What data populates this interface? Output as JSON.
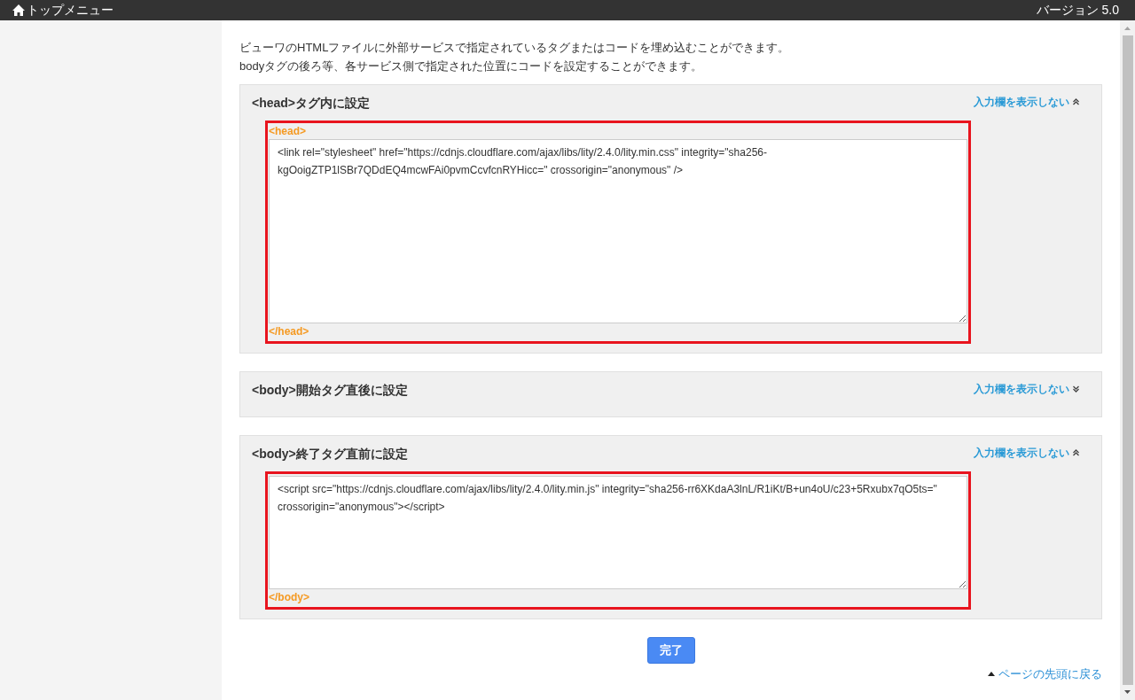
{
  "header": {
    "title": "トップメニュー",
    "version": "バージョン 5.0"
  },
  "intro": [
    "ビューワのHTMLファイルに外部サービスで指定されているタグまたはコードを埋め込むことができます。",
    "bodyタグの後ろ等、各サービス側で指定された位置にコードを設定することができます。"
  ],
  "sections": [
    {
      "title": "<head>タグ内に設定",
      "toggle": "入力欄を表示しない",
      "expanded": true,
      "open_tag": "<head>",
      "code": "<link rel=\"stylesheet\" href=\"https://cdnjs.cloudflare.com/ajax/libs/lity/2.4.0/lity.min.css\" integrity=\"sha256-kgOoigZTP1lSBr7QDdEQ4mcwFAi0pvmCcvfcnRYHicc=\" crossorigin=\"anonymous\" />",
      "close_tag": "</head>"
    },
    {
      "title": "<body>開始タグ直後に設定",
      "toggle": "入力欄を表示しない",
      "expanded": false
    },
    {
      "title": "<body>終了タグ直前に設定",
      "toggle": "入力欄を表示しない",
      "expanded": true,
      "code": "<script src=\"https://cdnjs.cloudflare.com/ajax/libs/lity/2.4.0/lity.min.js\" integrity=\"sha256-rr6XKdaA3lnL/R1iKt/B+un4oU/c23+5Rxubx7qO5ts=\" crossorigin=\"anonymous\"></script>",
      "close_tag": "</body>"
    }
  ],
  "done_button": "完了",
  "back_to_top": "ページの先頭に戻る"
}
